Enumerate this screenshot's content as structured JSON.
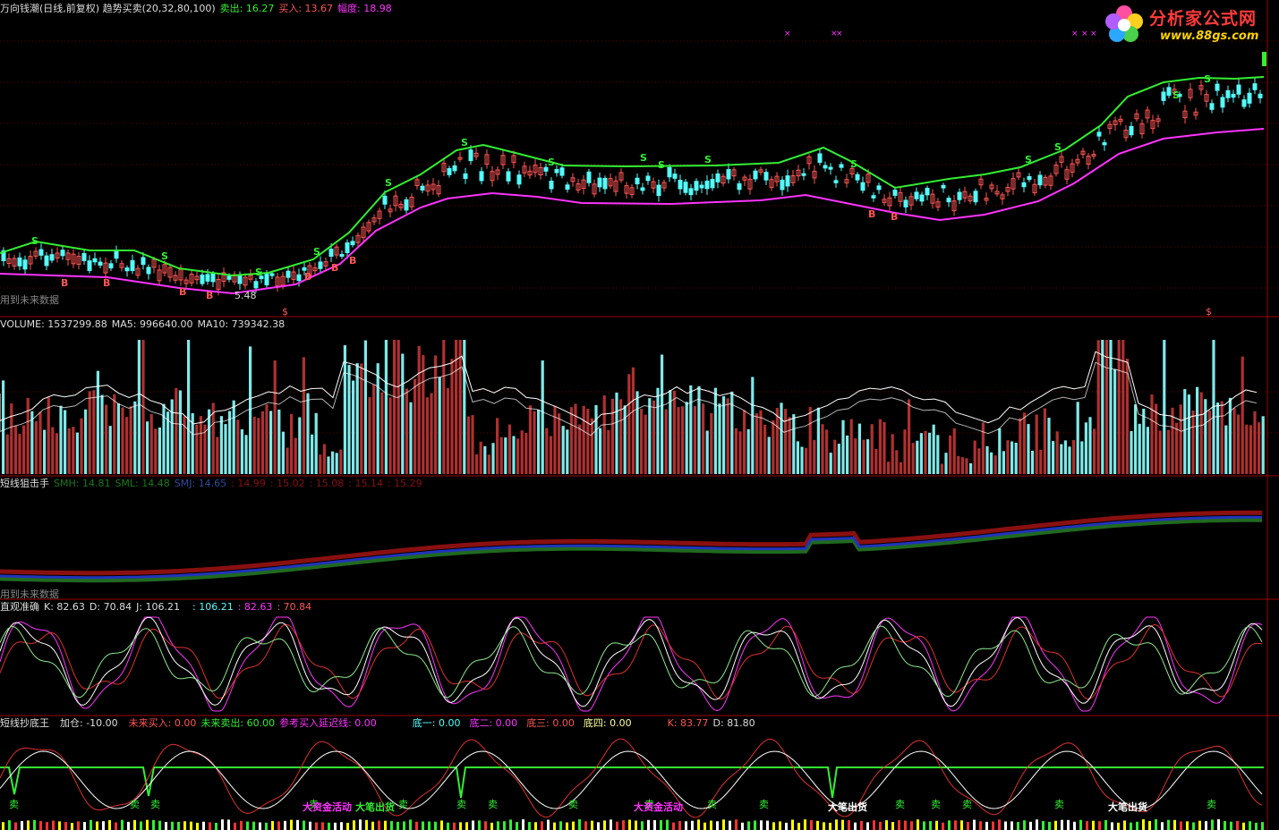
{
  "colors": {
    "up": "#ff5555",
    "down": "#54fcfc",
    "green": "#33ee33",
    "magenta": "#ff33ff",
    "white": "#ffffff",
    "divider": "#a00000",
    "grid": "#6a0000",
    "yellow": "#ffff00",
    "gray": "#888888"
  },
  "panel1": {
    "title": "万向钱潮(日线,前复权) 趋势买卖(20,32,80,100)",
    "sell_label": "卖出: 16.27",
    "buy_label": "买入: 13.67",
    "range_label": "幅度: 18.98",
    "note": "用到未来数据",
    "low_label": "5.48",
    "markers_s": "S",
    "markers_b": "B",
    "markers_dollar": "$",
    "markers_x": "×"
  },
  "panel2": {
    "volume_label": "VOLUME: 1537299.88",
    "ma5_label": "MA5: 996640.00",
    "ma10_label": "MA10: 739342.38"
  },
  "panel3": {
    "title": "短线狙击手",
    "smh": "SMH: 14.81",
    "sml": "SML: 14.48",
    "smj": "SMJ: 14.65",
    "v1": ": 14.99",
    "v2": ": 15.02",
    "v3": ": 15.08",
    "v4": ": 15.14",
    "v5": ": 15.29",
    "note": "用到未来数据"
  },
  "panel4": {
    "title": "直观准确",
    "k": "K: 82.63",
    "d": "D: 70.84",
    "j": "J: 106.21",
    "v1": ": 106.21",
    "v2": ": 82.63",
    "v3": ": 70.84"
  },
  "panel5": {
    "title": "短线抄底王",
    "add": "加仓: -10.00",
    "future_buy": "未来买入: 0.00",
    "future_sell": "未来卖出: 60.00",
    "ref_buy": "参考买入延迟线: 0.00",
    "bottom1": "底一: 0.00",
    "bottom2": "底二: 0.00",
    "bottom3": "底三: 0.00",
    "bottom4": "底四: 0.00",
    "k": "K: 83.77",
    "d": "D: 81.80",
    "sell_word": "卖",
    "big_money": "大资金活动",
    "big_out": "大笔出货"
  },
  "logo": {
    "title": "分析家公式网",
    "url": "www.88gs.com"
  }
}
